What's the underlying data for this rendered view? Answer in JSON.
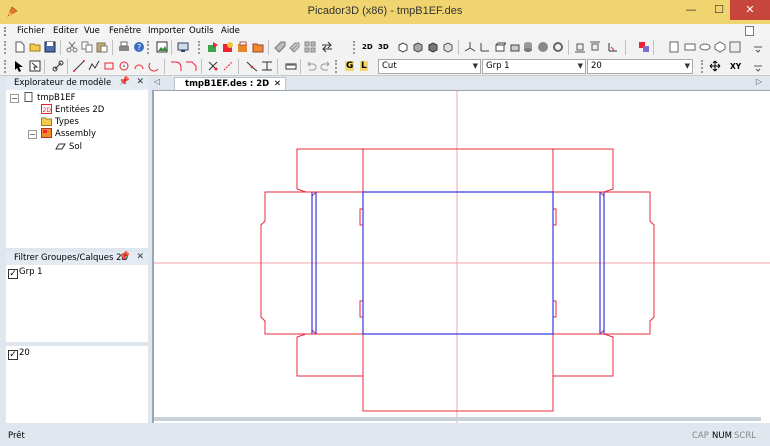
{
  "window": {
    "title": "Picador3D (x86) - tmpB1EF.des",
    "minimize": "—",
    "maximize": "☐",
    "close": "✕"
  },
  "menu": [
    "Fichier",
    "Editer",
    "Vue",
    "Fenêtre",
    "Importer",
    "Outils",
    "Aide"
  ],
  "toolbar2": {
    "btn_g": "G",
    "btn_l": "L",
    "combo_layer": "Cut",
    "combo_group": "Grp 1",
    "combo_size": "20",
    "xy_label": "XY"
  },
  "toolbar1": {
    "btn_2d_a": "2D",
    "btn_2d_b": "3D"
  },
  "explorer": {
    "title": "Explorateur de modèle",
    "items": [
      "tmpB1EF",
      "Entitées 2D",
      "Types",
      "Assembly",
      "Sol"
    ]
  },
  "filter": {
    "title": "Filtrer Groupes/Calques 2D",
    "groups": [
      "Grp 1"
    ],
    "layers": [
      "20"
    ]
  },
  "doc_tab": {
    "label": "tmpB1EF.des : 2D"
  },
  "status": {
    "text": "Prêt",
    "indicators": [
      "CAP",
      "NUM",
      "SCRL"
    ]
  },
  "colors": {
    "cut_line": "#e8283a",
    "crease_line": "#3a3ae0",
    "axis_line": "#f3a4ac",
    "title_bar": "#f0d470"
  }
}
